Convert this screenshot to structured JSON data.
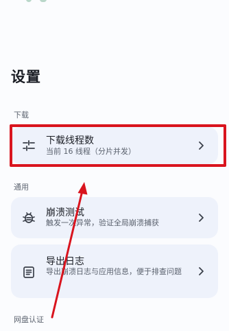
{
  "page": {
    "title": "设置"
  },
  "sections": {
    "download": {
      "label": "下载"
    },
    "general": {
      "label": "通用"
    },
    "netdisk": {
      "label": "网盘认证"
    }
  },
  "items": {
    "threads": {
      "title": "下载线程数",
      "subtitle": "当前 16 线程（分片并发）",
      "icon": "sliders-icon"
    },
    "crash_test": {
      "title": "崩溃测试",
      "subtitle": "触发一次异常，验证全局崩溃捕获",
      "icon": "bug-icon"
    },
    "export_log": {
      "title": "导出日志",
      "subtitle": "导出崩溃日志与应用信息，便于排查问题",
      "icon": "document-icon"
    }
  },
  "annotation": {
    "highlight_color": "#d9141e",
    "arrow_color": "#d9141e"
  }
}
